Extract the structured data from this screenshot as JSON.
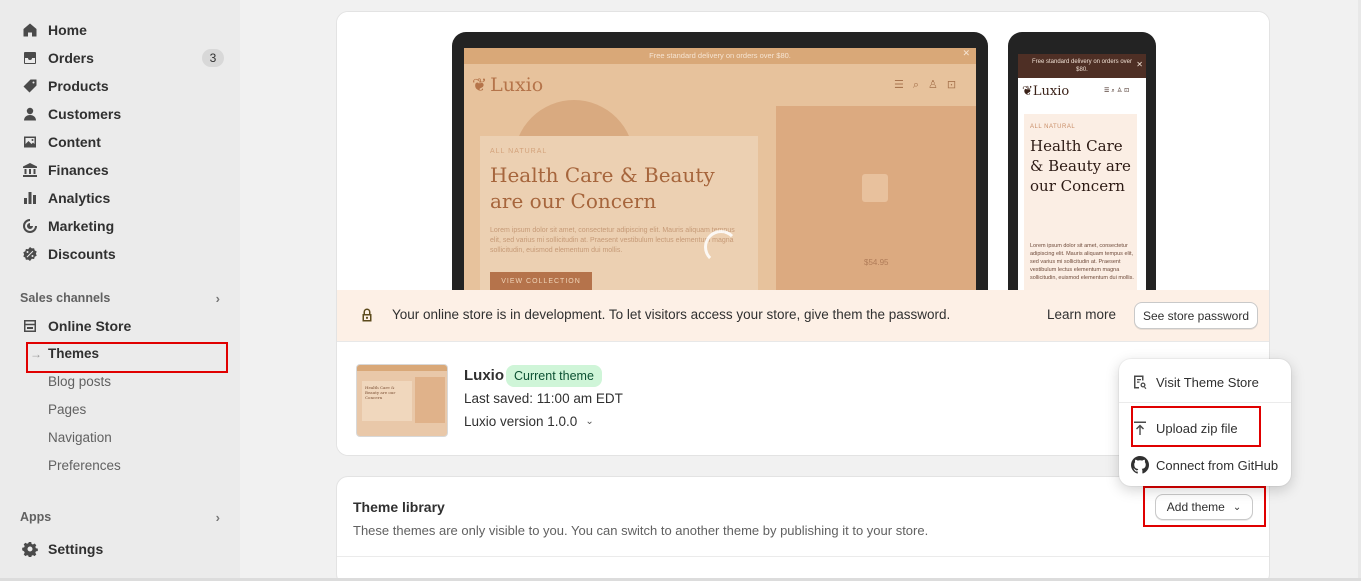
{
  "sidebar": {
    "items": [
      {
        "label": "Home",
        "icon": "home-icon"
      },
      {
        "label": "Orders",
        "icon": "orders-icon",
        "badge": "3"
      },
      {
        "label": "Products",
        "icon": "tag-icon"
      },
      {
        "label": "Customers",
        "icon": "person-icon"
      },
      {
        "label": "Content",
        "icon": "image-icon"
      },
      {
        "label": "Finances",
        "icon": "bank-icon"
      },
      {
        "label": "Analytics",
        "icon": "bar-chart-icon"
      },
      {
        "label": "Marketing",
        "icon": "target-icon"
      },
      {
        "label": "Discounts",
        "icon": "discount-icon"
      }
    ],
    "sales_channels_label": "Sales channels",
    "online_store_label": "Online Store",
    "online_store_sub": [
      "Themes",
      "Blog posts",
      "Pages",
      "Navigation",
      "Preferences"
    ],
    "apps_label": "Apps",
    "settings_label": "Settings"
  },
  "preview": {
    "laptop": {
      "announcement": "Free standard delivery on orders over $80.",
      "logo": "Luxio",
      "kicker": "ALL NATURAL",
      "headline": "Health Care & Beauty are our Concern",
      "body": "Lorem ipsum dolor sit amet, consectetur adipiscing elit. Mauris aliquam tempus elit, sed varius mi sollicitudin at. Praesent vestibulum lectus elementum magna sollicitudin, euismod elementum dui mollis.",
      "button": "VIEW COLLECTION",
      "price": "$54.95"
    },
    "phone": {
      "announcement": "Free standard delivery on orders over $80.",
      "logo": "Luxio",
      "kicker": "ALL NATURAL",
      "headline": "Health Care & Beauty are our Concern",
      "body": "Lorem ipsum dolor sit amet, consectetur adipiscing elit. Mauris aliquam tempus elit, sed varius mi sollicitudin at. Praesent vestibulum lectus elementum magna sollicitudin, euismod elementum dui mollis."
    }
  },
  "banner": {
    "text": "Your online store is in development. To let visitors access your store, give them the password.",
    "learn_more": "Learn more",
    "see_password": "See store password"
  },
  "current_theme": {
    "name": "Luxio",
    "badge": "Current theme",
    "last_saved": "Last saved: 11:00 am EDT",
    "version": "Luxio version 1.0.0",
    "thumb_headline": "Health Care & Beauty are our Concern"
  },
  "menu": {
    "items": [
      {
        "label": "Visit Theme Store",
        "icon": "theme-store-icon"
      },
      {
        "label": "Upload zip file",
        "icon": "upload-icon"
      },
      {
        "label": "Connect from GitHub",
        "icon": "github-icon"
      }
    ]
  },
  "library": {
    "title": "Theme library",
    "description": "These themes are only visible to you. You can switch to another theme by publishing it to your store.",
    "add_theme": "Add theme"
  },
  "colors": {
    "highlight": "#e00000",
    "badge_bg": "#cff5d8",
    "banner_bg": "#fdf0e6"
  }
}
